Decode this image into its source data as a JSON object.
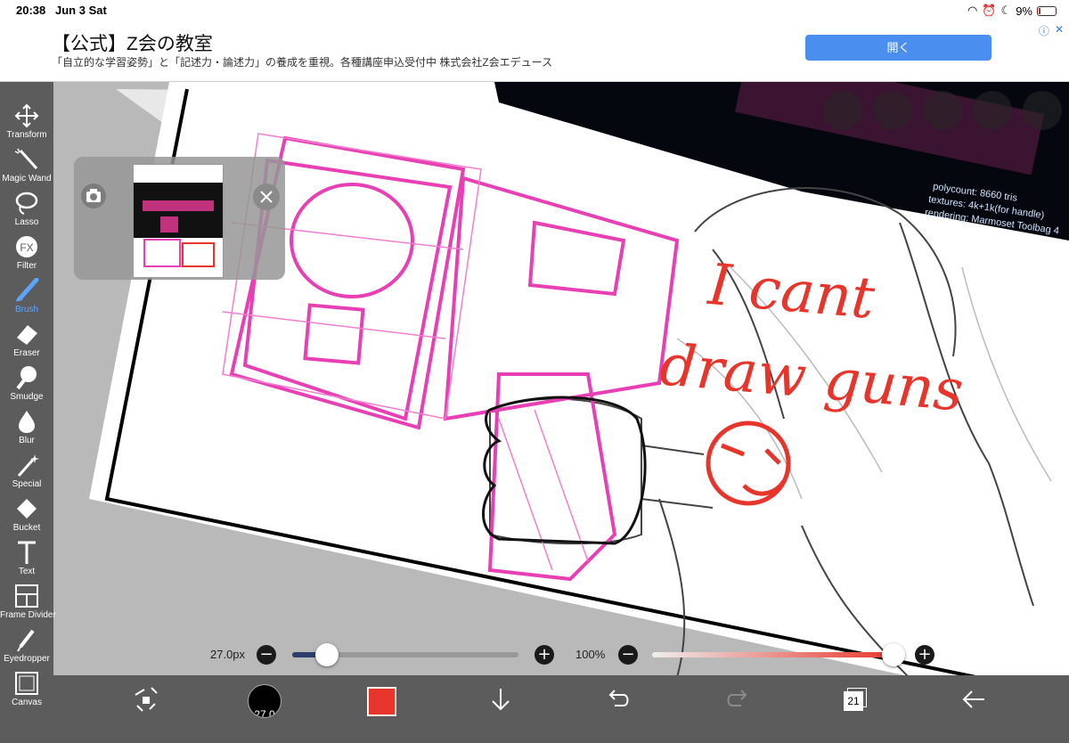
{
  "status_bar": {
    "time": "20:38",
    "date": "Jun 3 Sat",
    "battery": "9%"
  },
  "ad": {
    "title": "【公式】Z会の教室",
    "description": "「自立的な学習姿勢」と「記述力・論述力」の養成を重視。各種講座申込受付中 株式会社Z会エデュース",
    "button_label": "開く"
  },
  "tools": [
    {
      "name": "transform",
      "label": "Transform",
      "icon": "move-arrows-icon"
    },
    {
      "name": "magic-wand",
      "label": "Magic Wand",
      "icon": "magic-wand-icon"
    },
    {
      "name": "lasso",
      "label": "Lasso",
      "icon": "lasso-icon"
    },
    {
      "name": "filter",
      "label": "Filter",
      "icon": "fx-icon"
    },
    {
      "name": "brush",
      "label": "Brush",
      "icon": "brush-icon",
      "active": true
    },
    {
      "name": "eraser",
      "label": "Eraser",
      "icon": "eraser-icon"
    },
    {
      "name": "smudge",
      "label": "Smudge",
      "icon": "smudge-icon"
    },
    {
      "name": "blur",
      "label": "Blur",
      "icon": "droplet-icon"
    },
    {
      "name": "special",
      "label": "Special",
      "icon": "sparkle-icon"
    },
    {
      "name": "bucket",
      "label": "Bucket",
      "icon": "bucket-icon"
    },
    {
      "name": "text",
      "label": "Text",
      "icon": "text-icon"
    },
    {
      "name": "frame-divider",
      "label": "Frame Divider",
      "icon": "frame-divider-icon"
    },
    {
      "name": "eyedropper",
      "label": "Eyedropper",
      "icon": "eyedropper-icon"
    },
    {
      "name": "canvas",
      "label": "Canvas",
      "icon": "canvas-icon"
    }
  ],
  "canvas": {
    "handwriting_line1": "I cant",
    "handwriting_line2": "draw guns",
    "reference_text": [
      "polycount: 8660 tris",
      "textures: 4k+1k(for handle)",
      "rendering: Marmoset Toolbag 4"
    ]
  },
  "brush": {
    "size_label": "27.0px",
    "size_badge": "27.0",
    "size_fraction": 0.13,
    "opacity_label": "100%",
    "opacity_fraction": 1.0
  },
  "colors": {
    "brush_color": "#e8352b",
    "active_tool": "#5aa6ff",
    "toolbar_bg": "#5c5c5c",
    "sketch_pink": "#e83fb4"
  },
  "bottom_toolbar": {
    "layer_count": "21"
  }
}
